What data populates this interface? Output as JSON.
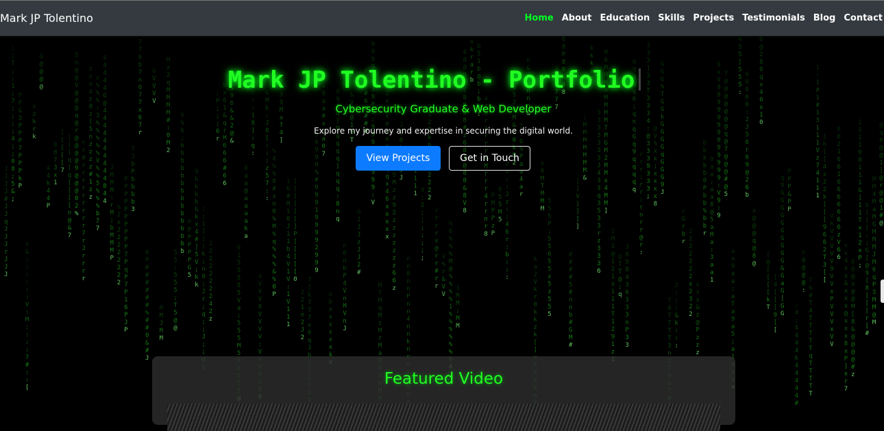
{
  "navbar": {
    "brand": "Mark JP Tolentino",
    "links": [
      {
        "label": "Home",
        "active": true
      },
      {
        "label": "About"
      },
      {
        "label": "Education"
      },
      {
        "label": "Skills"
      },
      {
        "label": "Projects"
      },
      {
        "label": "Testimonials"
      },
      {
        "label": "Blog"
      },
      {
        "label": "Contact"
      }
    ]
  },
  "hero": {
    "title": "Mark JP Tolentino - Portfolio",
    "subtitle": "Cybersecurity Graduate & Web Developer",
    "description": "Explore my journey and expertise in securing the digital world.",
    "primary_button": "View Projects",
    "secondary_button": "Get in Touch"
  },
  "featured": {
    "title": "Featured Video"
  },
  "colors": {
    "accent": "#22ff22",
    "navbar_bg": "#343a40",
    "primary_button": "#0d7bff",
    "background": "#000000"
  },
  "background_effect": "matrix-rain"
}
